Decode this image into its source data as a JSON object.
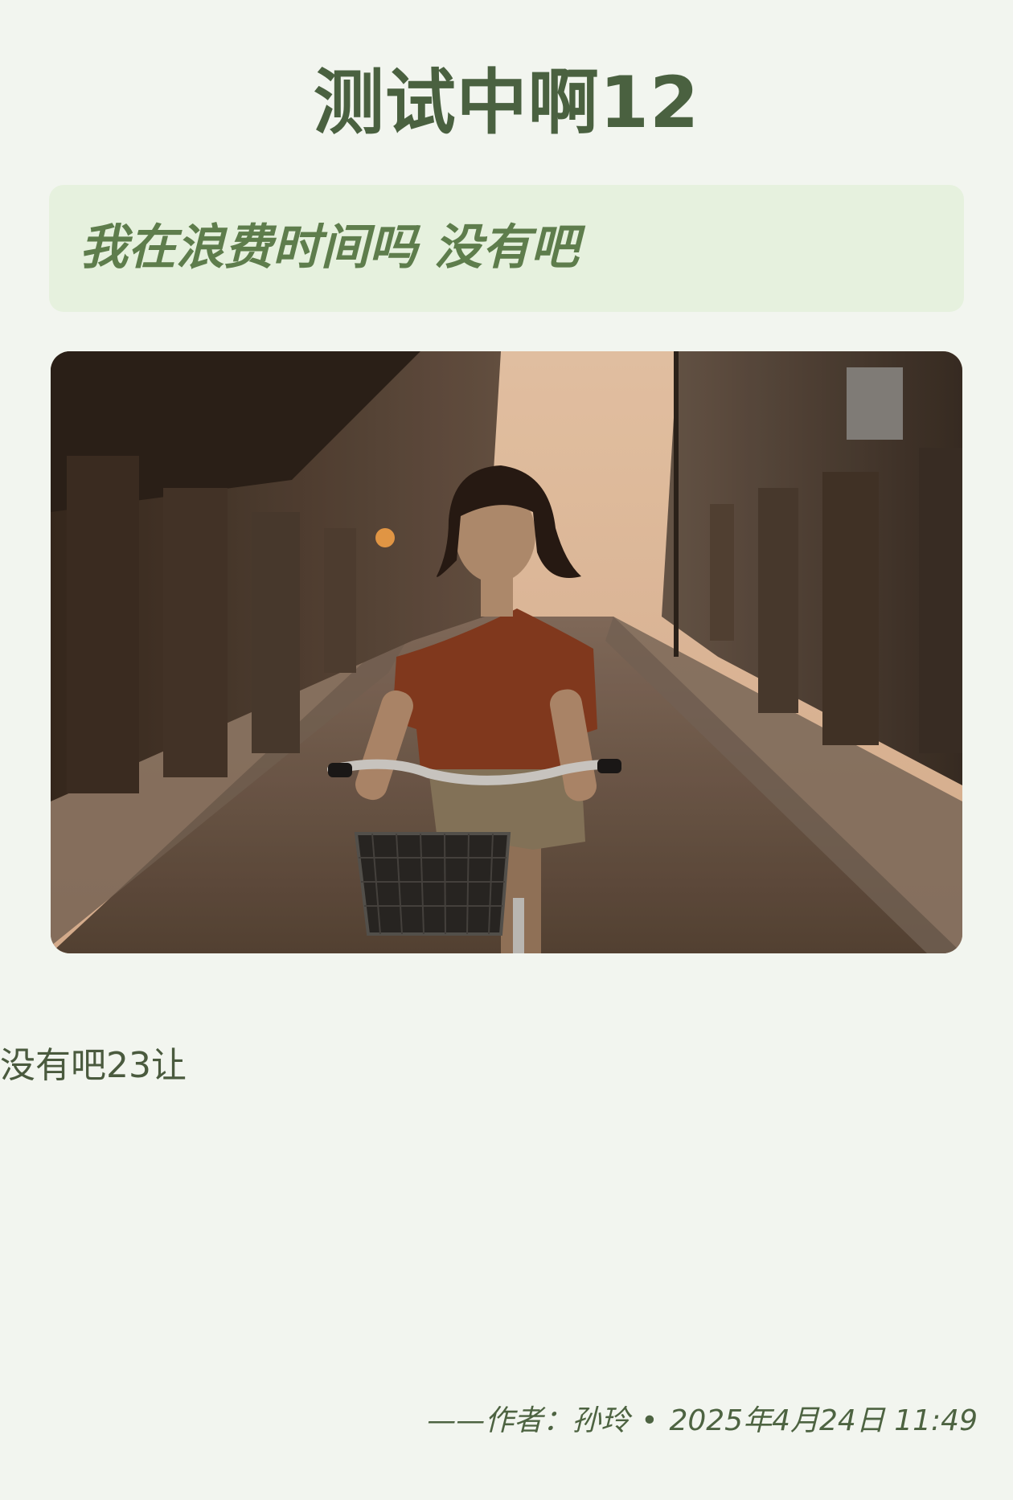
{
  "post": {
    "title": "测试中啊12",
    "quote": "我在浪费时间吗 没有吧",
    "body": "没有吧23让",
    "footer": {
      "prefix": "——作者：",
      "author": "孙玲",
      "separator": "•",
      "datetime": "2025年4月24日 11:49"
    }
  },
  "colors": {
    "background": "#f2f5ef",
    "title": "#4a6140",
    "quote_background": "#e6f1de",
    "quote_text": "#5e7d4c",
    "body_text": "#4a5a3e"
  }
}
